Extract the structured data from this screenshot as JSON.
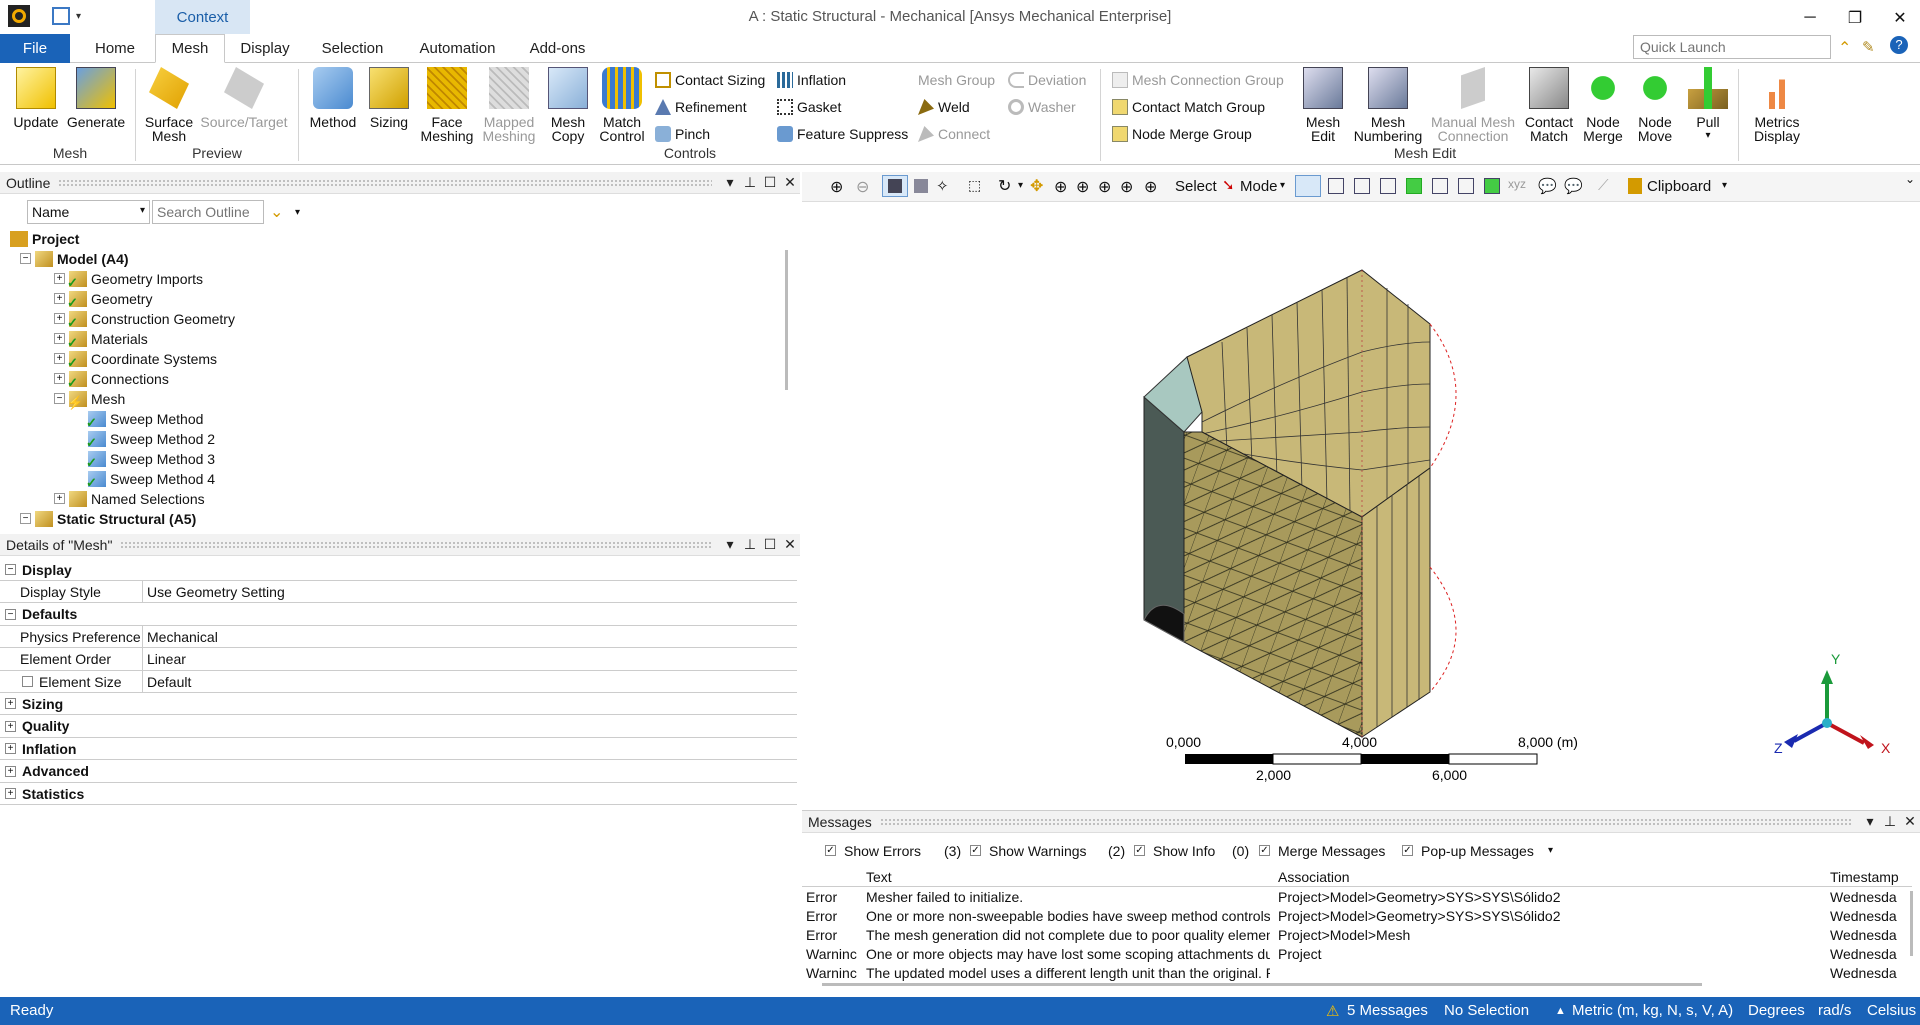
{
  "window": {
    "title": "A : Static Structural - Mechanical [Ansys Mechanical Enterprise]",
    "context_tab": "Context"
  },
  "tabs": [
    "File",
    "Home",
    "Mesh",
    "Display",
    "Selection",
    "Automation",
    "Add-ons"
  ],
  "quick_launch": {
    "placeholder": "Quick Launch"
  },
  "ribbon": {
    "mesh": {
      "update": "Update",
      "generate": "Generate",
      "group": "Mesh"
    },
    "preview": {
      "surface": "Surface Mesh",
      "source_target": "Source/Target",
      "group": "Preview"
    },
    "controls": {
      "method": "Method",
      "sizing": "Sizing",
      "face_meshing": "Face Meshing",
      "mapped_meshing": "Mapped Meshing",
      "mesh_copy": "Mesh Copy",
      "match_control": "Match Control",
      "contact_sizing": "Contact Sizing",
      "refinement": "Refinement",
      "pinch": "Pinch",
      "inflation": "Inflation",
      "gasket": "Gasket",
      "feature_suppress": "Feature Suppress",
      "mesh_group": "Mesh Group",
      "weld": "Weld",
      "connect": "Connect",
      "deviation": "Deviation",
      "washer": "Washer",
      "group": "Controls"
    },
    "mesh_edit": {
      "mesh_connection_group": "Mesh Connection Group",
      "contact_match_group": "Contact Match Group",
      "node_merge_group": "Node Merge Group",
      "mesh_edit": "Mesh Edit",
      "mesh_numbering": "Mesh Numbering",
      "manual_mesh_connection": "Manual Mesh Connection",
      "contact_match": "Contact Match",
      "node_merge": "Node Merge",
      "node_move": "Node Move",
      "pull": "Pull",
      "group": "Mesh Edit"
    },
    "metrics": {
      "metrics_display": "Metrics Display"
    }
  },
  "outline": {
    "title": "Outline",
    "filter": "Name",
    "search_placeholder": "Search Outline",
    "tree": [
      {
        "label": "Project",
        "level": 0,
        "bold": true
      },
      {
        "label": "Model (A4)",
        "level": 1,
        "bold": true
      },
      {
        "label": "Geometry Imports",
        "level": 2
      },
      {
        "label": "Geometry",
        "level": 2
      },
      {
        "label": "Construction Geometry",
        "level": 2
      },
      {
        "label": "Materials",
        "level": 2
      },
      {
        "label": "Coordinate Systems",
        "level": 2
      },
      {
        "label": "Connections",
        "level": 2
      },
      {
        "label": "Mesh",
        "level": 2
      },
      {
        "label": "Sweep Method",
        "level": 3
      },
      {
        "label": "Sweep Method 2",
        "level": 3
      },
      {
        "label": "Sweep Method 3",
        "level": 3
      },
      {
        "label": "Sweep Method 4",
        "level": 3
      },
      {
        "label": "Named Selections",
        "level": 2
      },
      {
        "label": "Static Structural (A5)",
        "level": 1,
        "bold": true
      }
    ]
  },
  "details": {
    "title": "Details of \"Mesh\"",
    "rows": [
      {
        "type": "cat",
        "label": "Display",
        "exp": "−"
      },
      {
        "type": "prop",
        "key": "Display Style",
        "value": "Use Geometry Setting"
      },
      {
        "type": "cat",
        "label": "Defaults",
        "exp": "−"
      },
      {
        "type": "prop",
        "key": "Physics Preference",
        "value": "Mechanical"
      },
      {
        "type": "prop",
        "key": "Element Order",
        "value": "Linear"
      },
      {
        "type": "prop",
        "key": "Element Size",
        "value": "Default",
        "check": true
      },
      {
        "type": "cat",
        "label": "Sizing",
        "exp": "+"
      },
      {
        "type": "cat",
        "label": "Quality",
        "exp": "+"
      },
      {
        "type": "cat",
        "label": "Inflation",
        "exp": "+"
      },
      {
        "type": "cat",
        "label": "Advanced",
        "exp": "+"
      },
      {
        "type": "cat",
        "label": "Statistics",
        "exp": "+"
      }
    ]
  },
  "viewport_toolbar": {
    "select": "Select",
    "mode": "Mode",
    "clipboard": "Clipboard"
  },
  "scale": {
    "t0": "0,000",
    "t1": "2,000",
    "t2": "4,000",
    "t3": "6,000",
    "t4": "8,000 (m)"
  },
  "triad": {
    "x": "X",
    "y": "Y",
    "z": "Z"
  },
  "messages": {
    "title": "Messages",
    "show_errors": "Show Errors",
    "errors_count": "(3)",
    "show_warnings": "Show Warnings",
    "warnings_count": "(2)",
    "show_info": "Show Info",
    "info_count": "(0)",
    "merge": "Merge Messages",
    "popup": "Pop-up Messages",
    "cols": {
      "text": "Text",
      "association": "Association",
      "timestamp": "Timestamp"
    },
    "rows": [
      {
        "type": "Error",
        "text": "Mesher failed to initialize.",
        "assoc": "Project>Model>Geometry>SYS>SYS\\Sólido2",
        "time": "Wednesda"
      },
      {
        "type": "Error",
        "text": "One or more non-sweepable bodies have sweep method controls and cannot be swept.",
        "assoc": "Project>Model>Geometry>SYS>SYS\\Sólido2",
        "time": "Wednesda"
      },
      {
        "type": "Error",
        "text": "The mesh generation did not complete due to poor quality elements or incorrect input. P",
        "assoc": "Project>Model>Mesh",
        "time": "Wednesda"
      },
      {
        "type": "Warninc",
        "text": "One or more objects may have lost some scoping attachments during the geometry updat",
        "assoc": "Project",
        "time": "Wednesda"
      },
      {
        "type": "Warninc",
        "text": "The updated model uses a different length unit than the original.  Please verify the lengtl",
        "assoc": "",
        "time": "Wednesda"
      }
    ]
  },
  "status": {
    "ready": "Ready",
    "messages": "5 Messages",
    "selection": "No Selection",
    "units": "Metric (m, kg, N, s, V, A)",
    "angle": "Degrees",
    "rate": "rad/s",
    "temp": "Celsius"
  }
}
